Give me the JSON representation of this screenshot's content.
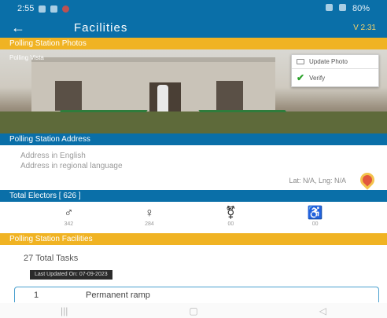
{
  "status_bar": {
    "time": "2:55",
    "right_text": "80%"
  },
  "app_bar": {
    "back_glyph": "←",
    "title": "Facilities",
    "version": "V 2.31"
  },
  "photo_section": {
    "heading": "Polling Station Photos",
    "overlay_caption": "Polling Vista",
    "menu": {
      "update_label": "Update Photo",
      "verify_label": "Verify"
    }
  },
  "address_section": {
    "heading": "Polling Station Address",
    "line_english": "Address in English",
    "line_regional": "Address in regional language",
    "latlng": "Lat: N/A, Lng: N/A"
  },
  "electors_section": {
    "heading": "Total Electors [ 626 ]",
    "items": [
      {
        "icon": "male-voter-icon",
        "glyph": "♂",
        "value": "342"
      },
      {
        "icon": "female-voter-icon",
        "glyph": "♀",
        "value": "284"
      },
      {
        "icon": "third-gender-icon",
        "glyph": "⚧",
        "value": "00"
      },
      {
        "icon": "disabled-voter-icon",
        "glyph": "♿",
        "value": "00"
      }
    ]
  },
  "facilities_section": {
    "heading": "Polling Station Facilities",
    "total_tasks": "27 Total Tasks",
    "tag": "Last Updated On: 07-09-2023",
    "first_item": {
      "index": "1",
      "label": "Permanent ramp"
    }
  },
  "nav_bar": {
    "recents": "|||",
    "home": "▢",
    "back": "◁"
  },
  "colors": {
    "primary": "#0a6fa8",
    "accent": "#f0b323",
    "verify": "#2aa12a"
  }
}
